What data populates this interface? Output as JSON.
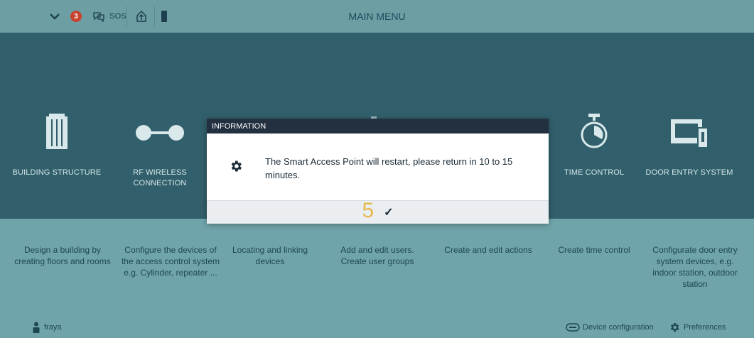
{
  "topbar": {
    "title": "MAIN MENU",
    "notification_count": "3",
    "sos_label": "SOS",
    "icons": [
      "chevron-down-icon",
      "notification-badge",
      "chat-icon",
      "sos",
      "home-up-icon",
      "phone-device-icon"
    ]
  },
  "menu": {
    "items": [
      {
        "label": "BUILDING STRUCTURE",
        "icon": "building-icon",
        "description": "Design a building by creating floors and rooms"
      },
      {
        "label": "RF WIRELESS CONNECTION",
        "icon": "connection-icon",
        "description": "Configure the devices of the access control system e.g. Cylinder, repeater ..."
      },
      {
        "label": "",
        "icon": "",
        "description": "Locating and linking devices"
      },
      {
        "label": "",
        "icon": "",
        "description": "Add and edit users. Create user groups"
      },
      {
        "label": "",
        "icon": "",
        "description": "Create and edit actions"
      },
      {
        "label": "TIME CONTROL",
        "icon": "stopwatch-icon",
        "description": "Create time control"
      },
      {
        "label": "DOOR ENTRY SYSTEM",
        "icon": "door-entry-icon",
        "description": "Configurate door entry system devices, e.g. indoor station, outdoor station"
      }
    ]
  },
  "footer": {
    "user": "fraya",
    "device_config": "Device configuration",
    "preferences": "Preferences"
  },
  "modal": {
    "header": "INFORMATION",
    "message": "The Smart Access Point will restart, please return in 10 to 15 minutes.",
    "countdown": "5",
    "confirm_glyph": "✓"
  },
  "colors": {
    "topbar": "#6c9ea4",
    "band": "#315f6b",
    "background": "#6fa4aa",
    "modal_header": "#233040",
    "countdown": "#e5b949",
    "badge": "#c9412f"
  }
}
